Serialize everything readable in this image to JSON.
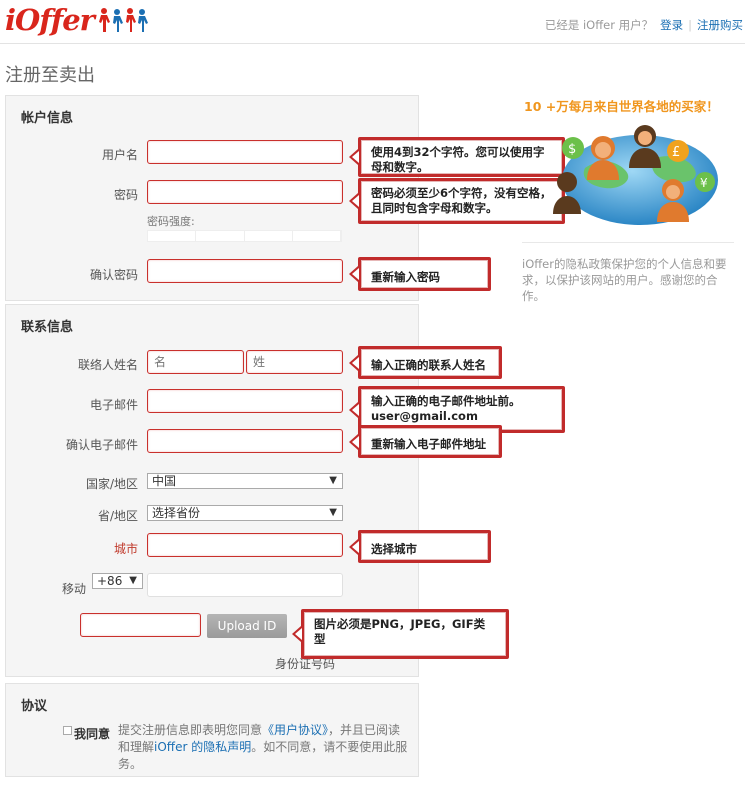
{
  "header": {
    "logo_text": "iOffer",
    "already_user": "已经是 iOffer 用户？",
    "login_link": "登录",
    "register_buy_link": "注册购买"
  },
  "page": {
    "title": "注册至卖出"
  },
  "account": {
    "heading": "帐户信息",
    "username_label": "用户名",
    "password_label": "密码",
    "password_strength_label": "密码强度:",
    "confirm_password_label": "确认密码",
    "tips": {
      "username": "使用4到32个字符。您可以使用字母和数字。",
      "password": "密码必须至少6个字符，没有空格，且同时包含字母和数字。",
      "confirm_password": "重新输入密码"
    }
  },
  "contact": {
    "heading": "联系信息",
    "contact_name_label": "联络人姓名",
    "first_name_placeholder": "名",
    "last_name_placeholder": "姓",
    "email_label": "电子邮件",
    "confirm_email_label": "确认电子邮件",
    "country_label": "国家/地区",
    "country_value": "中国",
    "province_label": "省/地区",
    "province_value": "选择省份",
    "city_label": "城市",
    "mobile_label": "移动",
    "mobile_code_value": "+86",
    "upload_button": "Upload ID",
    "id_number_label": "身份证号码",
    "tips": {
      "name": "输入正确的联系人姓名",
      "email": "输入正确的电子邮件地址前。user@gmail.com",
      "confirm_email": "重新输入电子邮件地址",
      "city": "选择城市",
      "upload": "图片必须是PNG，JPEG，GIF类型"
    }
  },
  "agreement": {
    "heading": "协议",
    "agree_label": "我同意",
    "text_1": "提交注册信息即表明您同意",
    "user_agreement_link": "《用户协议》",
    "text_2": "，并且已阅读和理解",
    "privacy_link": "iOffer 的隐私声明",
    "text_3": "。如不同意，请不要使用此服务。"
  },
  "sidebar": {
    "headline": "10 +万每月来自世界各地的买家！",
    "privacy_text": "iOffer的隐私政策保护您的个人信息和要求，以保护该网站的用户。感谢您的合作。"
  },
  "colors": {
    "brand_red": "#d9261c",
    "tip_red": "#c12b2b",
    "link_blue": "#1b6fb3",
    "sidebar_orange": "#f0961e"
  },
  "icons": {
    "logo_people": "people-holding-hands-icon",
    "dropdown_arrow": "triangle-down-icon",
    "globe_buyers": "globe-buyers-illustration"
  }
}
